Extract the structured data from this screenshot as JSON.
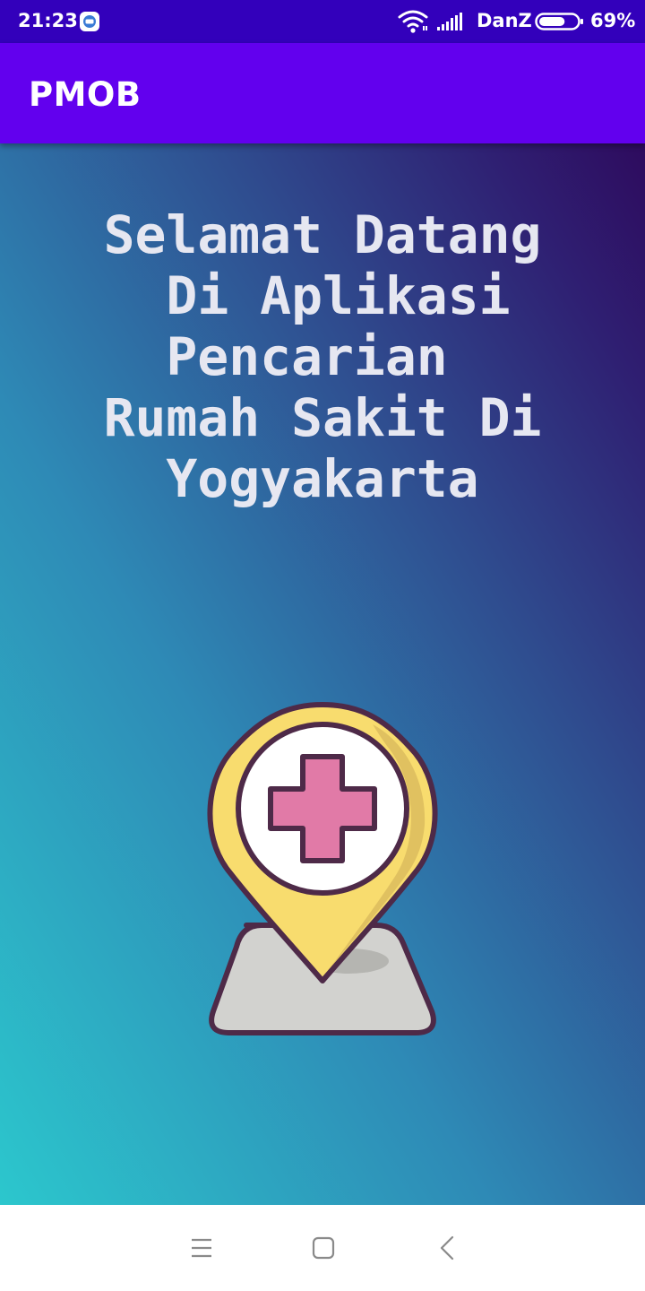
{
  "status_bar": {
    "time": "21:23",
    "carrier": "DanZ",
    "battery_percent": "69%",
    "battery_level": 0.69,
    "icons": [
      "app-notification-icon",
      "wifi-icon",
      "cellular-signal-icon",
      "battery-icon"
    ]
  },
  "app_bar": {
    "title": "PMOB"
  },
  "main": {
    "welcome_text": "Selamat Datang\n Di Aplikasi\nPencarian \nRumah Sakit Di\nYogyakarta",
    "illustration": "hospital-location-pin-icon"
  },
  "nav_bar": {
    "buttons": [
      "menu-icon",
      "home-icon",
      "back-icon"
    ]
  },
  "colors": {
    "status_bar": "#3300bb",
    "app_bar": "#6200ee",
    "gradient_top": "#2e0b5e",
    "gradient_bottom": "#2cc7cd",
    "pin_yellow": "#f8dc6e",
    "cross_pink": "#e17aa7",
    "outline": "#4e2a48",
    "base_gray": "#d2d2cf"
  }
}
